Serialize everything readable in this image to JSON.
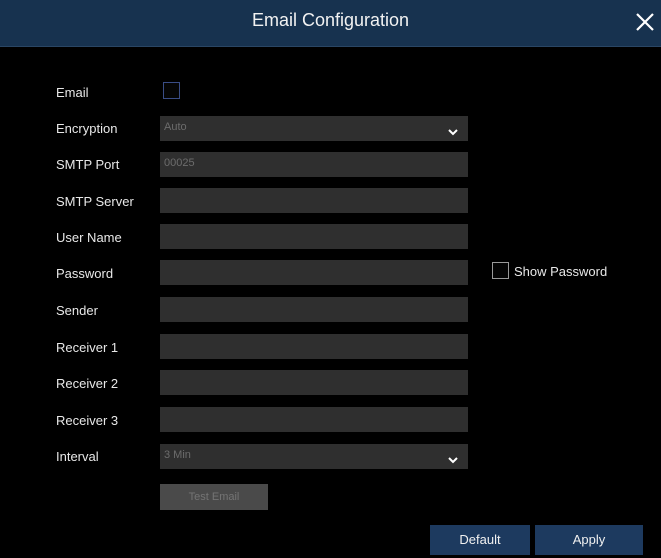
{
  "dialog": {
    "title": "Email Configuration",
    "close_icon": "close-icon"
  },
  "form": {
    "email": {
      "label": "Email",
      "checked": false
    },
    "encryption": {
      "label": "Encryption",
      "value": "Auto",
      "icon": "chevron-down-icon"
    },
    "smtp_port": {
      "label": "SMTP Port",
      "value": "00025"
    },
    "smtp_server": {
      "label": "SMTP Server",
      "value": ""
    },
    "user_name": {
      "label": "User Name",
      "value": ""
    },
    "password": {
      "label": "Password",
      "value": ""
    },
    "show_password": {
      "label": "Show Password",
      "checked": false
    },
    "sender": {
      "label": "Sender",
      "value": ""
    },
    "receiver1": {
      "label": "Receiver 1",
      "value": ""
    },
    "receiver2": {
      "label": "Receiver 2",
      "value": ""
    },
    "receiver3": {
      "label": "Receiver 3",
      "value": ""
    },
    "interval": {
      "label": "Interval",
      "value": "3 Min",
      "icon": "chevron-down-icon"
    }
  },
  "buttons": {
    "test_email": "Test Email",
    "default": "Default",
    "apply": "Apply"
  },
  "colors": {
    "titlebar": "#17324f",
    "field_bg": "#2f2f2f",
    "button_blue": "#1d3a5f"
  }
}
